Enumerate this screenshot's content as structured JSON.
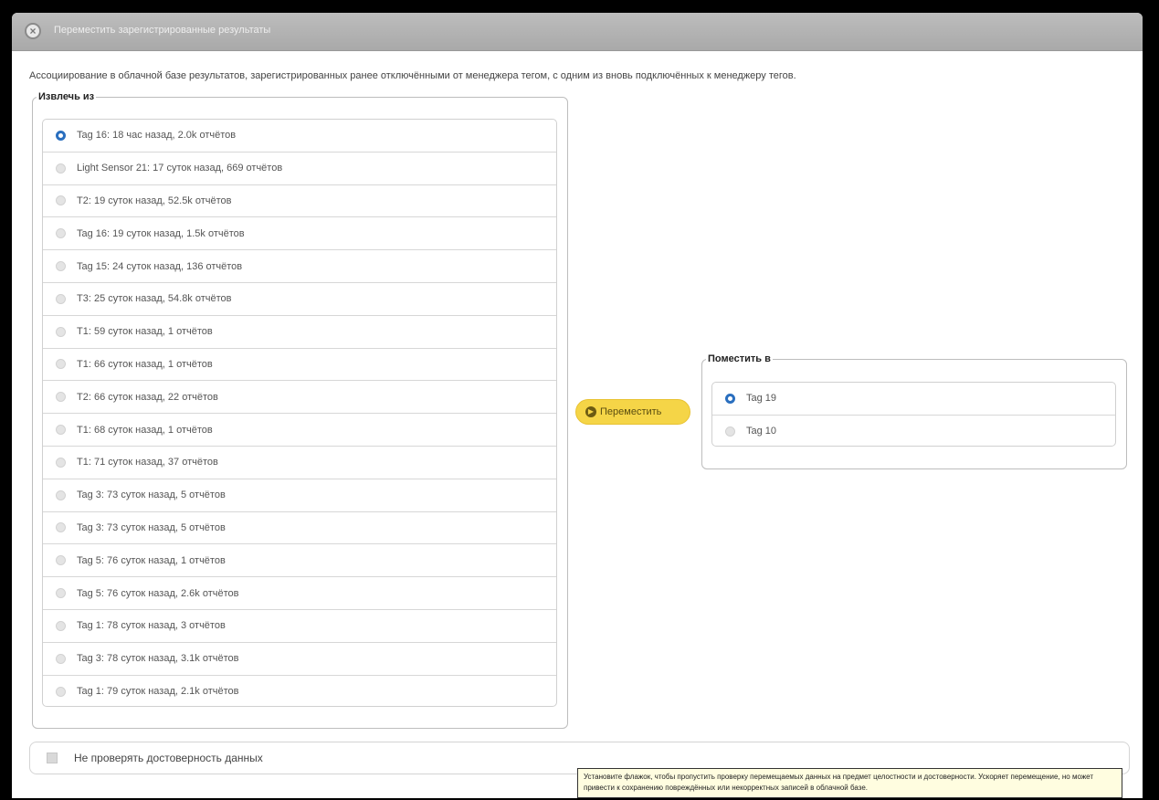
{
  "dialog": {
    "title": "Переместить зарегистрированные результаты",
    "description": "Ассоциирование в облачной базе результатов, зарегистрированных ранее отключёнными от менеджера тегом, с одним из вновь подключённых к менеджеру тегов."
  },
  "from_group": {
    "legend": "Извлечь из",
    "items": [
      {
        "label": "Tag 16: 18 час назад, 2.0k отчётов",
        "selected": true
      },
      {
        "label": "Light Sensor 21: 17 суток назад, 669 отчётов",
        "selected": false
      },
      {
        "label": "T2: 19 суток назад, 52.5k отчётов",
        "selected": false
      },
      {
        "label": "Tag 16: 19 суток назад, 1.5k отчётов",
        "selected": false
      },
      {
        "label": "Tag 15: 24 суток назад, 136 отчётов",
        "selected": false
      },
      {
        "label": "T3: 25 суток назад, 54.8k отчётов",
        "selected": false
      },
      {
        "label": "T1: 59 суток назад, 1 отчётов",
        "selected": false
      },
      {
        "label": "T1: 66 суток назад, 1 отчётов",
        "selected": false
      },
      {
        "label": "T2: 66 суток назад, 22 отчётов",
        "selected": false
      },
      {
        "label": "T1: 68 суток назад, 1 отчётов",
        "selected": false
      },
      {
        "label": "T1: 71 суток назад, 37 отчётов",
        "selected": false
      },
      {
        "label": "Tag 3: 73 суток назад, 5 отчётов",
        "selected": false
      },
      {
        "label": "Tag 3: 73 суток назад, 5 отчётов",
        "selected": false
      },
      {
        "label": "Tag 5: 76 суток назад, 1 отчётов",
        "selected": false
      },
      {
        "label": "Tag 5: 76 суток назад, 2.6k отчётов",
        "selected": false
      },
      {
        "label": "Tag 1: 78 суток назад, 3 отчётов",
        "selected": false
      },
      {
        "label": "Tag 3: 78 суток назад, 3.1k отчётов",
        "selected": false
      },
      {
        "label": "Tag 1: 79 суток назад, 2.1k отчётов",
        "selected": false
      }
    ]
  },
  "move_button": {
    "label": "Переместить"
  },
  "to_group": {
    "legend": "Поместить в",
    "items": [
      {
        "label": "Tag 19",
        "selected": true
      },
      {
        "label": "Tag 10",
        "selected": false
      }
    ]
  },
  "integrity_check": {
    "label": "Не проверять достоверность данных"
  },
  "tooltip": {
    "text": "Установите флажок, чтобы пропустить проверку перемещаемых данных на предмет целостности и достоверности. Ускоряет перемещение, но может привести к сохранению повреждённых или некорректных записей в облачной базе."
  }
}
